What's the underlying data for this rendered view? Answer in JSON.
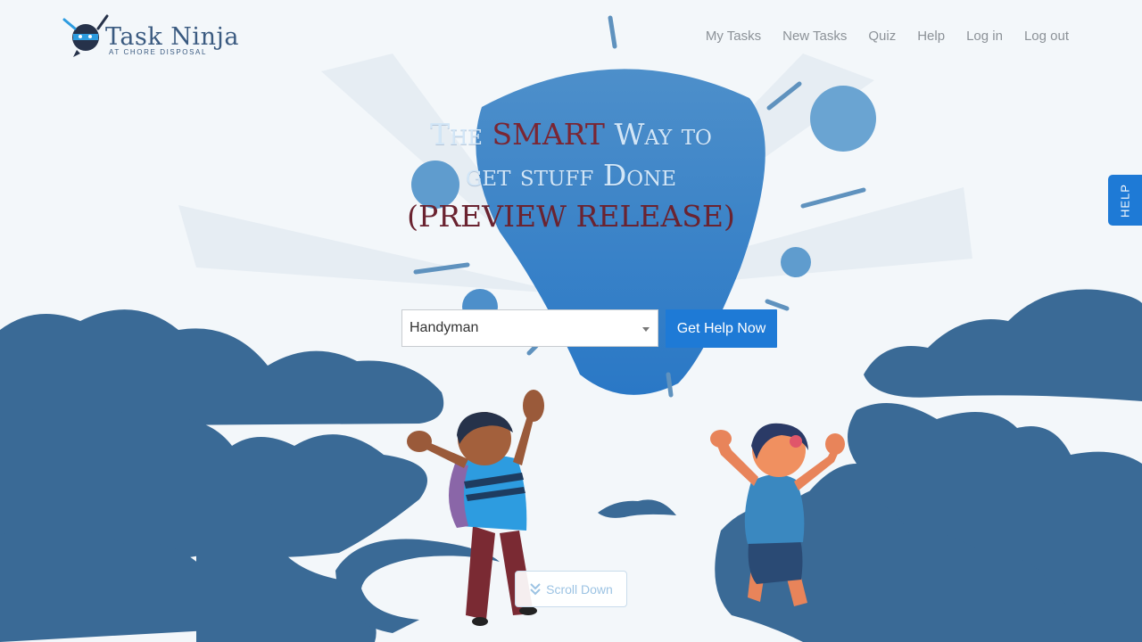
{
  "logo": {
    "title": "Task Ninja",
    "subtitle": "AT CHORE DISPOSAL",
    "icon": "ninja-icon"
  },
  "nav": {
    "items": [
      {
        "label": "My Tasks"
      },
      {
        "label": "New Tasks"
      },
      {
        "label": "Quiz"
      },
      {
        "label": "Help"
      },
      {
        "label": "Log in"
      },
      {
        "label": "Log out"
      }
    ]
  },
  "hero": {
    "line1_pre": "The ",
    "line1_highlight": "SMART",
    "line1_post": " Way to",
    "line2": "get stuff Done",
    "line3": "(PREVIEW RELEASE)"
  },
  "form": {
    "category_value": "Handyman",
    "submit_label": "Get Help Now"
  },
  "side_tab": {
    "label": "HELP"
  },
  "scroll": {
    "label": "Scroll Down",
    "icon": "double-chevron-down-icon"
  },
  "colors": {
    "primary": "#1e7ad6",
    "cloud": "#3a6a96",
    "highlight": "#7a2633",
    "nav_text": "#8c9298"
  }
}
